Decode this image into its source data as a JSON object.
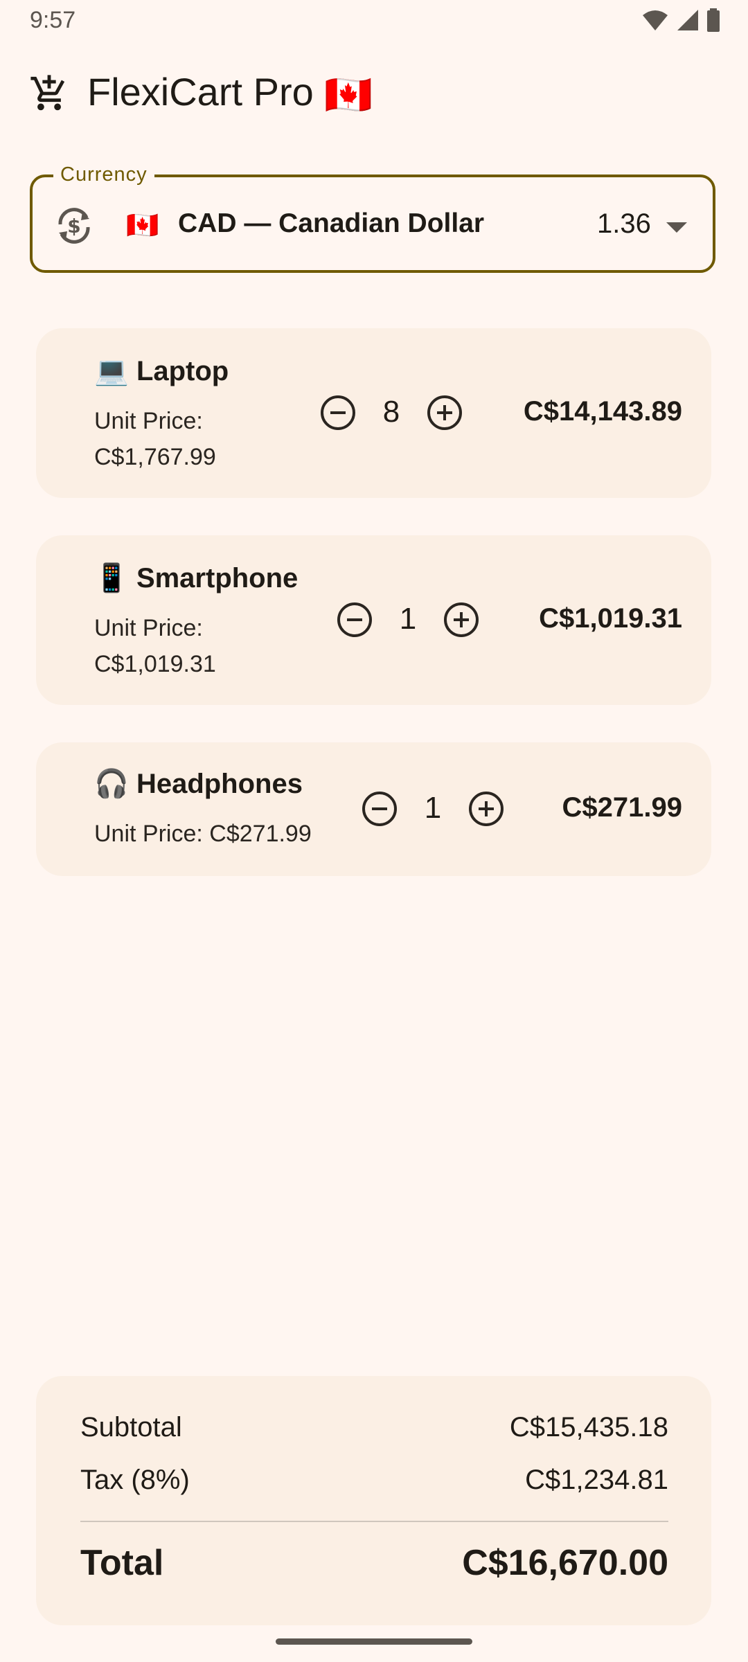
{
  "status_bar": {
    "time": "9:57"
  },
  "app_bar": {
    "title": "FlexiCart Pro",
    "flag": "🇨🇦"
  },
  "currency": {
    "label": "Currency",
    "flag": "🇨🇦",
    "name": "CAD — Canadian Dollar",
    "rate": "1.36"
  },
  "items": [
    {
      "emoji": "💻",
      "name": "Laptop",
      "unit_price_label": "Unit Price:",
      "unit_price": "C$1,767.99",
      "quantity": "8",
      "total": "C$14,143.89"
    },
    {
      "emoji": "📱",
      "name": "Smartphone",
      "unit_price_label": "Unit Price:",
      "unit_price": "C$1,019.31",
      "quantity": "1",
      "total": "C$1,019.31"
    },
    {
      "emoji": "🎧",
      "name": "Headphones",
      "unit_price_label": "Unit Price:",
      "unit_price": "C$271.99",
      "quantity": "1",
      "total": "C$271.99"
    }
  ],
  "summary": {
    "subtotal_label": "Subtotal",
    "subtotal_value": "C$15,435.18",
    "tax_label": "Tax (8%)",
    "tax_value": "C$1,234.81",
    "total_label": "Total",
    "total_value": "C$16,670.00"
  },
  "colors": {
    "background": "#fff6f1",
    "card": "#fbefe4",
    "outline_accent": "#6f5a00",
    "text": "#1f1b16"
  }
}
